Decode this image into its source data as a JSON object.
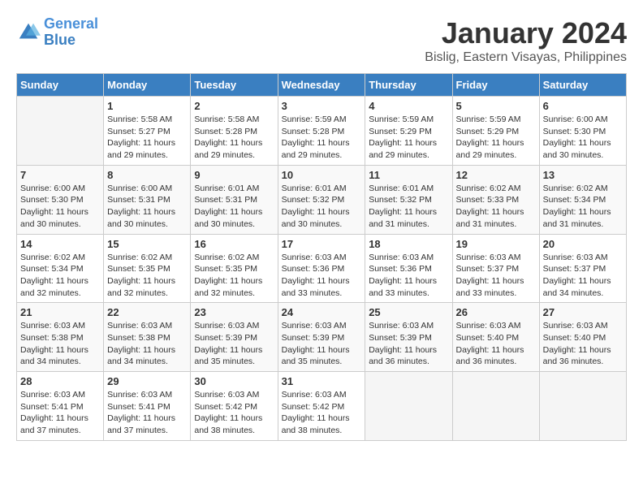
{
  "header": {
    "logo_line1": "General",
    "logo_line2": "Blue",
    "title": "January 2024",
    "subtitle": "Bislig, Eastern Visayas, Philippines"
  },
  "days_of_week": [
    "Sunday",
    "Monday",
    "Tuesday",
    "Wednesday",
    "Thursday",
    "Friday",
    "Saturday"
  ],
  "weeks": [
    [
      {
        "day": "",
        "sunrise": "",
        "sunset": "",
        "daylight": ""
      },
      {
        "day": "1",
        "sunrise": "Sunrise: 5:58 AM",
        "sunset": "Sunset: 5:27 PM",
        "daylight": "Daylight: 11 hours and 29 minutes."
      },
      {
        "day": "2",
        "sunrise": "Sunrise: 5:58 AM",
        "sunset": "Sunset: 5:28 PM",
        "daylight": "Daylight: 11 hours and 29 minutes."
      },
      {
        "day": "3",
        "sunrise": "Sunrise: 5:59 AM",
        "sunset": "Sunset: 5:28 PM",
        "daylight": "Daylight: 11 hours and 29 minutes."
      },
      {
        "day": "4",
        "sunrise": "Sunrise: 5:59 AM",
        "sunset": "Sunset: 5:29 PM",
        "daylight": "Daylight: 11 hours and 29 minutes."
      },
      {
        "day": "5",
        "sunrise": "Sunrise: 5:59 AM",
        "sunset": "Sunset: 5:29 PM",
        "daylight": "Daylight: 11 hours and 29 minutes."
      },
      {
        "day": "6",
        "sunrise": "Sunrise: 6:00 AM",
        "sunset": "Sunset: 5:30 PM",
        "daylight": "Daylight: 11 hours and 30 minutes."
      }
    ],
    [
      {
        "day": "7",
        "sunrise": "Sunrise: 6:00 AM",
        "sunset": "Sunset: 5:30 PM",
        "daylight": "Daylight: 11 hours and 30 minutes."
      },
      {
        "day": "8",
        "sunrise": "Sunrise: 6:00 AM",
        "sunset": "Sunset: 5:31 PM",
        "daylight": "Daylight: 11 hours and 30 minutes."
      },
      {
        "day": "9",
        "sunrise": "Sunrise: 6:01 AM",
        "sunset": "Sunset: 5:31 PM",
        "daylight": "Daylight: 11 hours and 30 minutes."
      },
      {
        "day": "10",
        "sunrise": "Sunrise: 6:01 AM",
        "sunset": "Sunset: 5:32 PM",
        "daylight": "Daylight: 11 hours and 30 minutes."
      },
      {
        "day": "11",
        "sunrise": "Sunrise: 6:01 AM",
        "sunset": "Sunset: 5:32 PM",
        "daylight": "Daylight: 11 hours and 31 minutes."
      },
      {
        "day": "12",
        "sunrise": "Sunrise: 6:02 AM",
        "sunset": "Sunset: 5:33 PM",
        "daylight": "Daylight: 11 hours and 31 minutes."
      },
      {
        "day": "13",
        "sunrise": "Sunrise: 6:02 AM",
        "sunset": "Sunset: 5:34 PM",
        "daylight": "Daylight: 11 hours and 31 minutes."
      }
    ],
    [
      {
        "day": "14",
        "sunrise": "Sunrise: 6:02 AM",
        "sunset": "Sunset: 5:34 PM",
        "daylight": "Daylight: 11 hours and 32 minutes."
      },
      {
        "day": "15",
        "sunrise": "Sunrise: 6:02 AM",
        "sunset": "Sunset: 5:35 PM",
        "daylight": "Daylight: 11 hours and 32 minutes."
      },
      {
        "day": "16",
        "sunrise": "Sunrise: 6:02 AM",
        "sunset": "Sunset: 5:35 PM",
        "daylight": "Daylight: 11 hours and 32 minutes."
      },
      {
        "day": "17",
        "sunrise": "Sunrise: 6:03 AM",
        "sunset": "Sunset: 5:36 PM",
        "daylight": "Daylight: 11 hours and 33 minutes."
      },
      {
        "day": "18",
        "sunrise": "Sunrise: 6:03 AM",
        "sunset": "Sunset: 5:36 PM",
        "daylight": "Daylight: 11 hours and 33 minutes."
      },
      {
        "day": "19",
        "sunrise": "Sunrise: 6:03 AM",
        "sunset": "Sunset: 5:37 PM",
        "daylight": "Daylight: 11 hours and 33 minutes."
      },
      {
        "day": "20",
        "sunrise": "Sunrise: 6:03 AM",
        "sunset": "Sunset: 5:37 PM",
        "daylight": "Daylight: 11 hours and 34 minutes."
      }
    ],
    [
      {
        "day": "21",
        "sunrise": "Sunrise: 6:03 AM",
        "sunset": "Sunset: 5:38 PM",
        "daylight": "Daylight: 11 hours and 34 minutes."
      },
      {
        "day": "22",
        "sunrise": "Sunrise: 6:03 AM",
        "sunset": "Sunset: 5:38 PM",
        "daylight": "Daylight: 11 hours and 34 minutes."
      },
      {
        "day": "23",
        "sunrise": "Sunrise: 6:03 AM",
        "sunset": "Sunset: 5:39 PM",
        "daylight": "Daylight: 11 hours and 35 minutes."
      },
      {
        "day": "24",
        "sunrise": "Sunrise: 6:03 AM",
        "sunset": "Sunset: 5:39 PM",
        "daylight": "Daylight: 11 hours and 35 minutes."
      },
      {
        "day": "25",
        "sunrise": "Sunrise: 6:03 AM",
        "sunset": "Sunset: 5:39 PM",
        "daylight": "Daylight: 11 hours and 36 minutes."
      },
      {
        "day": "26",
        "sunrise": "Sunrise: 6:03 AM",
        "sunset": "Sunset: 5:40 PM",
        "daylight": "Daylight: 11 hours and 36 minutes."
      },
      {
        "day": "27",
        "sunrise": "Sunrise: 6:03 AM",
        "sunset": "Sunset: 5:40 PM",
        "daylight": "Daylight: 11 hours and 36 minutes."
      }
    ],
    [
      {
        "day": "28",
        "sunrise": "Sunrise: 6:03 AM",
        "sunset": "Sunset: 5:41 PM",
        "daylight": "Daylight: 11 hours and 37 minutes."
      },
      {
        "day": "29",
        "sunrise": "Sunrise: 6:03 AM",
        "sunset": "Sunset: 5:41 PM",
        "daylight": "Daylight: 11 hours and 37 minutes."
      },
      {
        "day": "30",
        "sunrise": "Sunrise: 6:03 AM",
        "sunset": "Sunset: 5:42 PM",
        "daylight": "Daylight: 11 hours and 38 minutes."
      },
      {
        "day": "31",
        "sunrise": "Sunrise: 6:03 AM",
        "sunset": "Sunset: 5:42 PM",
        "daylight": "Daylight: 11 hours and 38 minutes."
      },
      {
        "day": "",
        "sunrise": "",
        "sunset": "",
        "daylight": ""
      },
      {
        "day": "",
        "sunrise": "",
        "sunset": "",
        "daylight": ""
      },
      {
        "day": "",
        "sunrise": "",
        "sunset": "",
        "daylight": ""
      }
    ]
  ]
}
